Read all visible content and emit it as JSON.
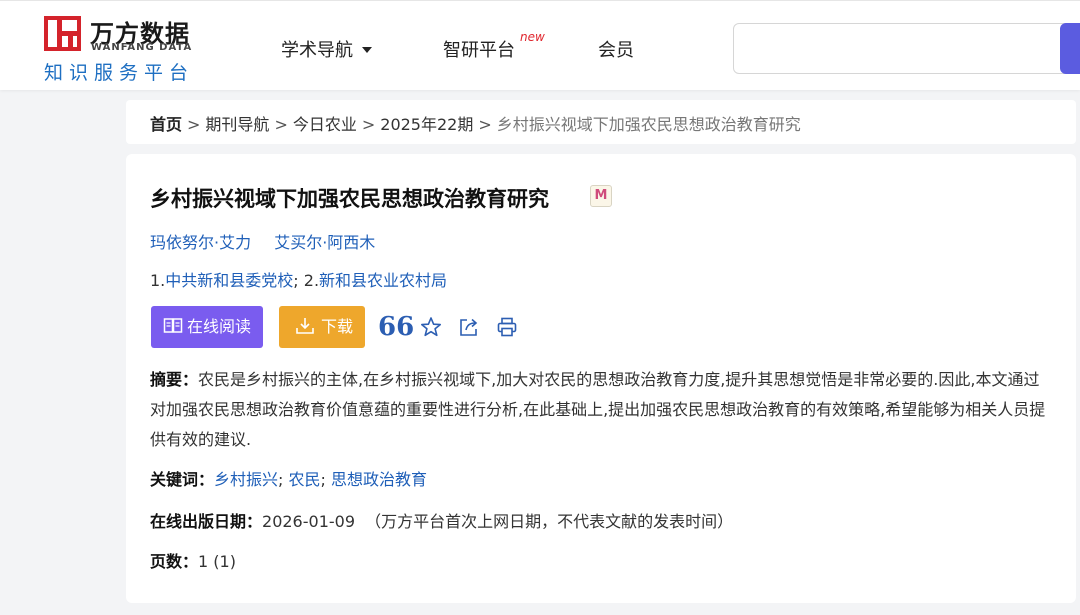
{
  "header": {
    "logo": {
      "cn": "万方数据",
      "en": "WANFANG DATA",
      "slogan": "知识服务平台"
    },
    "nav": [
      {
        "label": "学术导航",
        "dropdown": true
      },
      {
        "label": "智研平台",
        "badge": "new"
      },
      {
        "label": "会员"
      }
    ],
    "search": {
      "placeholder": ""
    }
  },
  "breadcrumb": {
    "items": [
      "首页",
      "期刊导航",
      "今日农业",
      "2025年22期",
      "乡村振兴视域下加强农民思想政治教育研究"
    ],
    "separator": ">"
  },
  "article": {
    "title": "乡村振兴视域下加强农民思想政治教育研究",
    "badge_letter": "M",
    "authors": [
      "玛依努尔·艾力",
      "艾买尔·阿西木"
    ],
    "affiliations": {
      "prefix1": "1.",
      "org1": "中共新和县委党校",
      "sep": "; 2.",
      "org2": "新和县农业农村局"
    },
    "actions": {
      "read_label": "在线阅读",
      "download_label": "下载",
      "cite_symbol": "66",
      "icon_names": [
        "cite-icon",
        "star-icon",
        "share-icon",
        "print-icon"
      ]
    },
    "abstract": {
      "label": "摘要：",
      "text": "农民是乡村振兴的主体,在乡村振兴视域下,加大对农民的思想政治教育力度,提升其思想觉悟是非常必要的.因此,本文通过对加强农民思想政治教育价值意蕴的重要性进行分析,在此基础上,提出加强农民思想政治教育的有效策略,希望能够为相关人员提供有效的建议."
    },
    "keywords": {
      "label": "关键词：",
      "items": [
        "乡村振兴",
        "农民",
        "思想政治教育"
      ],
      "separator": "; "
    },
    "publish": {
      "label": "在线出版日期：",
      "date": "2026-01-09",
      "note": "（万方平台首次上网日期，不代表文献的发表时间）"
    },
    "pages": {
      "label": "页数：",
      "value": "1 (1)"
    }
  },
  "colors": {
    "accent_purple": "#7a5cef",
    "accent_orange": "#eea72c",
    "link_blue": "#1f5fb8",
    "logo_red": "#d4232b",
    "search_button": "#5b5ce0"
  }
}
